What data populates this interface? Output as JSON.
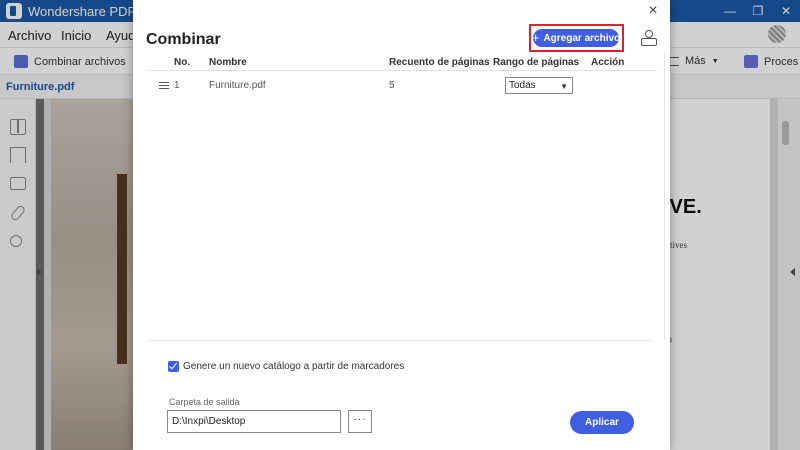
{
  "app": {
    "title": "Wondershare PDFelemen",
    "window_controls": [
      "—",
      "❐",
      "✕"
    ]
  },
  "menu": {
    "items": [
      "Archivo",
      "Inicio",
      "Ayud"
    ]
  },
  "toolbar": {
    "combine_label": "Combinar archivos",
    "more_label": "Más",
    "process_label": "Proces"
  },
  "tabs": {
    "file_tab": "Furniture.pdf"
  },
  "background_doc": {
    "headline": "IVE.",
    "lines": [
      "atives",
      "a"
    ]
  },
  "dialog": {
    "title": "Combinar",
    "add_button": "Agregar archivo",
    "close_symbol": "×",
    "columns": [
      "No.",
      "Nombre",
      "Recuento de páginas",
      "Rango de páginas",
      "Acción"
    ],
    "rows": [
      {
        "no": "1",
        "name": "Furniture.pdf",
        "pages": "5",
        "range": "Todas"
      }
    ],
    "bookmark_checkbox": {
      "label": "Genere un nuevo catálogo a partir de marcadores",
      "checked": true
    },
    "output_folder": {
      "label": "Carpeta de salida",
      "value": "D:\\Inxpi\\Desktop"
    },
    "browse_button": "···",
    "apply_button": "Aplicar"
  },
  "colors": {
    "accent": "#3f5fe0",
    "titlebar": "#1c5aa8",
    "highlight": "#e0202c"
  }
}
